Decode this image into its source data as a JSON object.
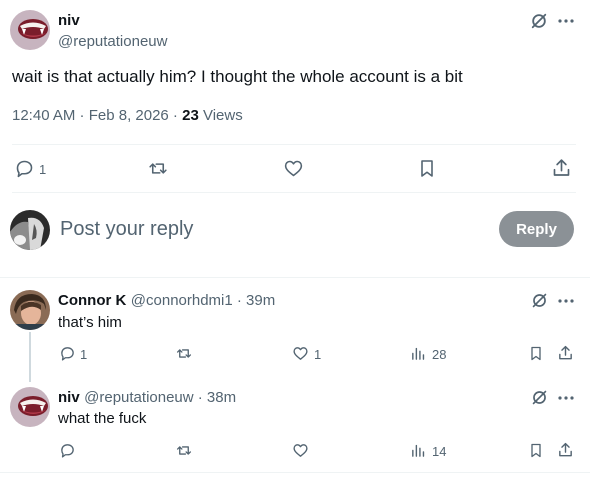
{
  "main_post": {
    "name": "niv",
    "handle": "@reputationeuw",
    "text": "wait is that actually him? I thought the whole account is a bit",
    "time": "12:40 AM · Feb 8, 2026 · ",
    "views_count": "23",
    "views_label": " Views",
    "actions": {
      "reply_count": "1"
    }
  },
  "composer": {
    "placeholder": "Post your reply",
    "button_label": "Reply"
  },
  "replies": [
    {
      "name": "Connor K",
      "handle": "@connorhdmi1 · 39m",
      "text": "that’s him",
      "reply_count": "1",
      "like_count": "1",
      "views_count": "28"
    },
    {
      "name": "niv",
      "handle": "@reputationeuw · 38m",
      "text": "what the fuck",
      "reply_count": "",
      "like_count": "",
      "views_count": "14"
    }
  ],
  "colors": {
    "text": "#0f1419",
    "secondary": "#536471",
    "divider": "#eff3f4",
    "reply_button_disabled": "#8b9196"
  },
  "icons": [
    "grok-icon",
    "more-icon",
    "reply-icon",
    "retweet-icon",
    "like-icon",
    "bookmark-icon",
    "share-icon",
    "views-icon"
  ]
}
